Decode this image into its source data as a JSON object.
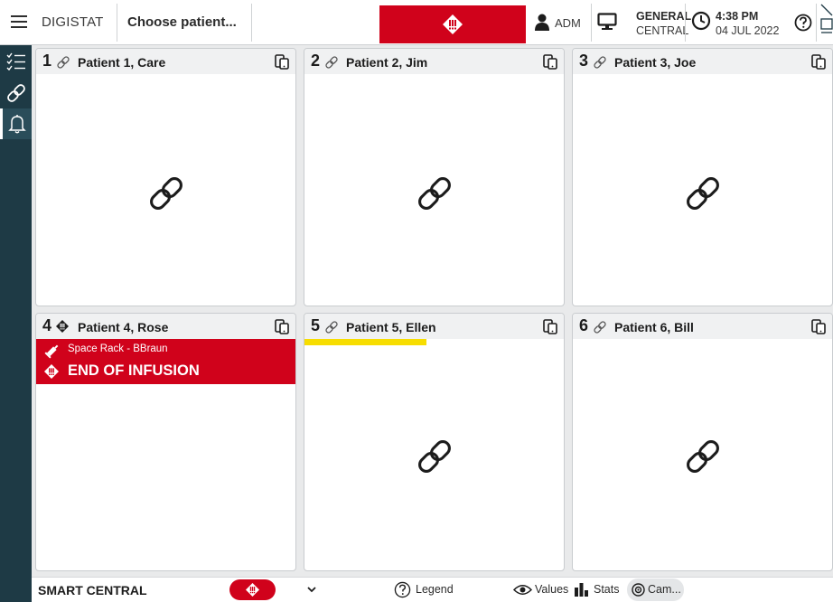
{
  "topbar": {
    "app_name": "DIGISTAT",
    "patient_selector": "Choose patient...",
    "user": "ADM",
    "station_name": "GENERAL",
    "station_sub": "CENTRAL",
    "time": "4:38 PM",
    "date": "04 JUL 2022"
  },
  "cards": [
    {
      "bed": "1",
      "name": "Patient 1, Care",
      "status_icon": "link-icon"
    },
    {
      "bed": "2",
      "name": "Patient 2, Jim",
      "status_icon": "link-icon"
    },
    {
      "bed": "3",
      "name": "Patient 3, Joe",
      "status_icon": "link-icon"
    },
    {
      "bed": "4",
      "name": "Patient 4, Rose",
      "status_icon": "alarm-icon",
      "alarm": {
        "device": "Space Rack - BBraun",
        "text": "END OF INFUSION"
      }
    },
    {
      "bed": "5",
      "name": "Patient 5, Ellen",
      "status_icon": "link-icon",
      "progress": 0.47
    },
    {
      "bed": "6",
      "name": "Patient 6, Bill",
      "status_icon": "link-icon"
    }
  ],
  "bottombar": {
    "title": "SMART CENTRAL",
    "legend": "Legend",
    "values": "Values",
    "stats": "Stats",
    "camera": "Cam..."
  },
  "colors": {
    "alarm_red": "#d0021b",
    "sidebar": "#1e3a45",
    "warning_yellow": "#f7dd00"
  }
}
